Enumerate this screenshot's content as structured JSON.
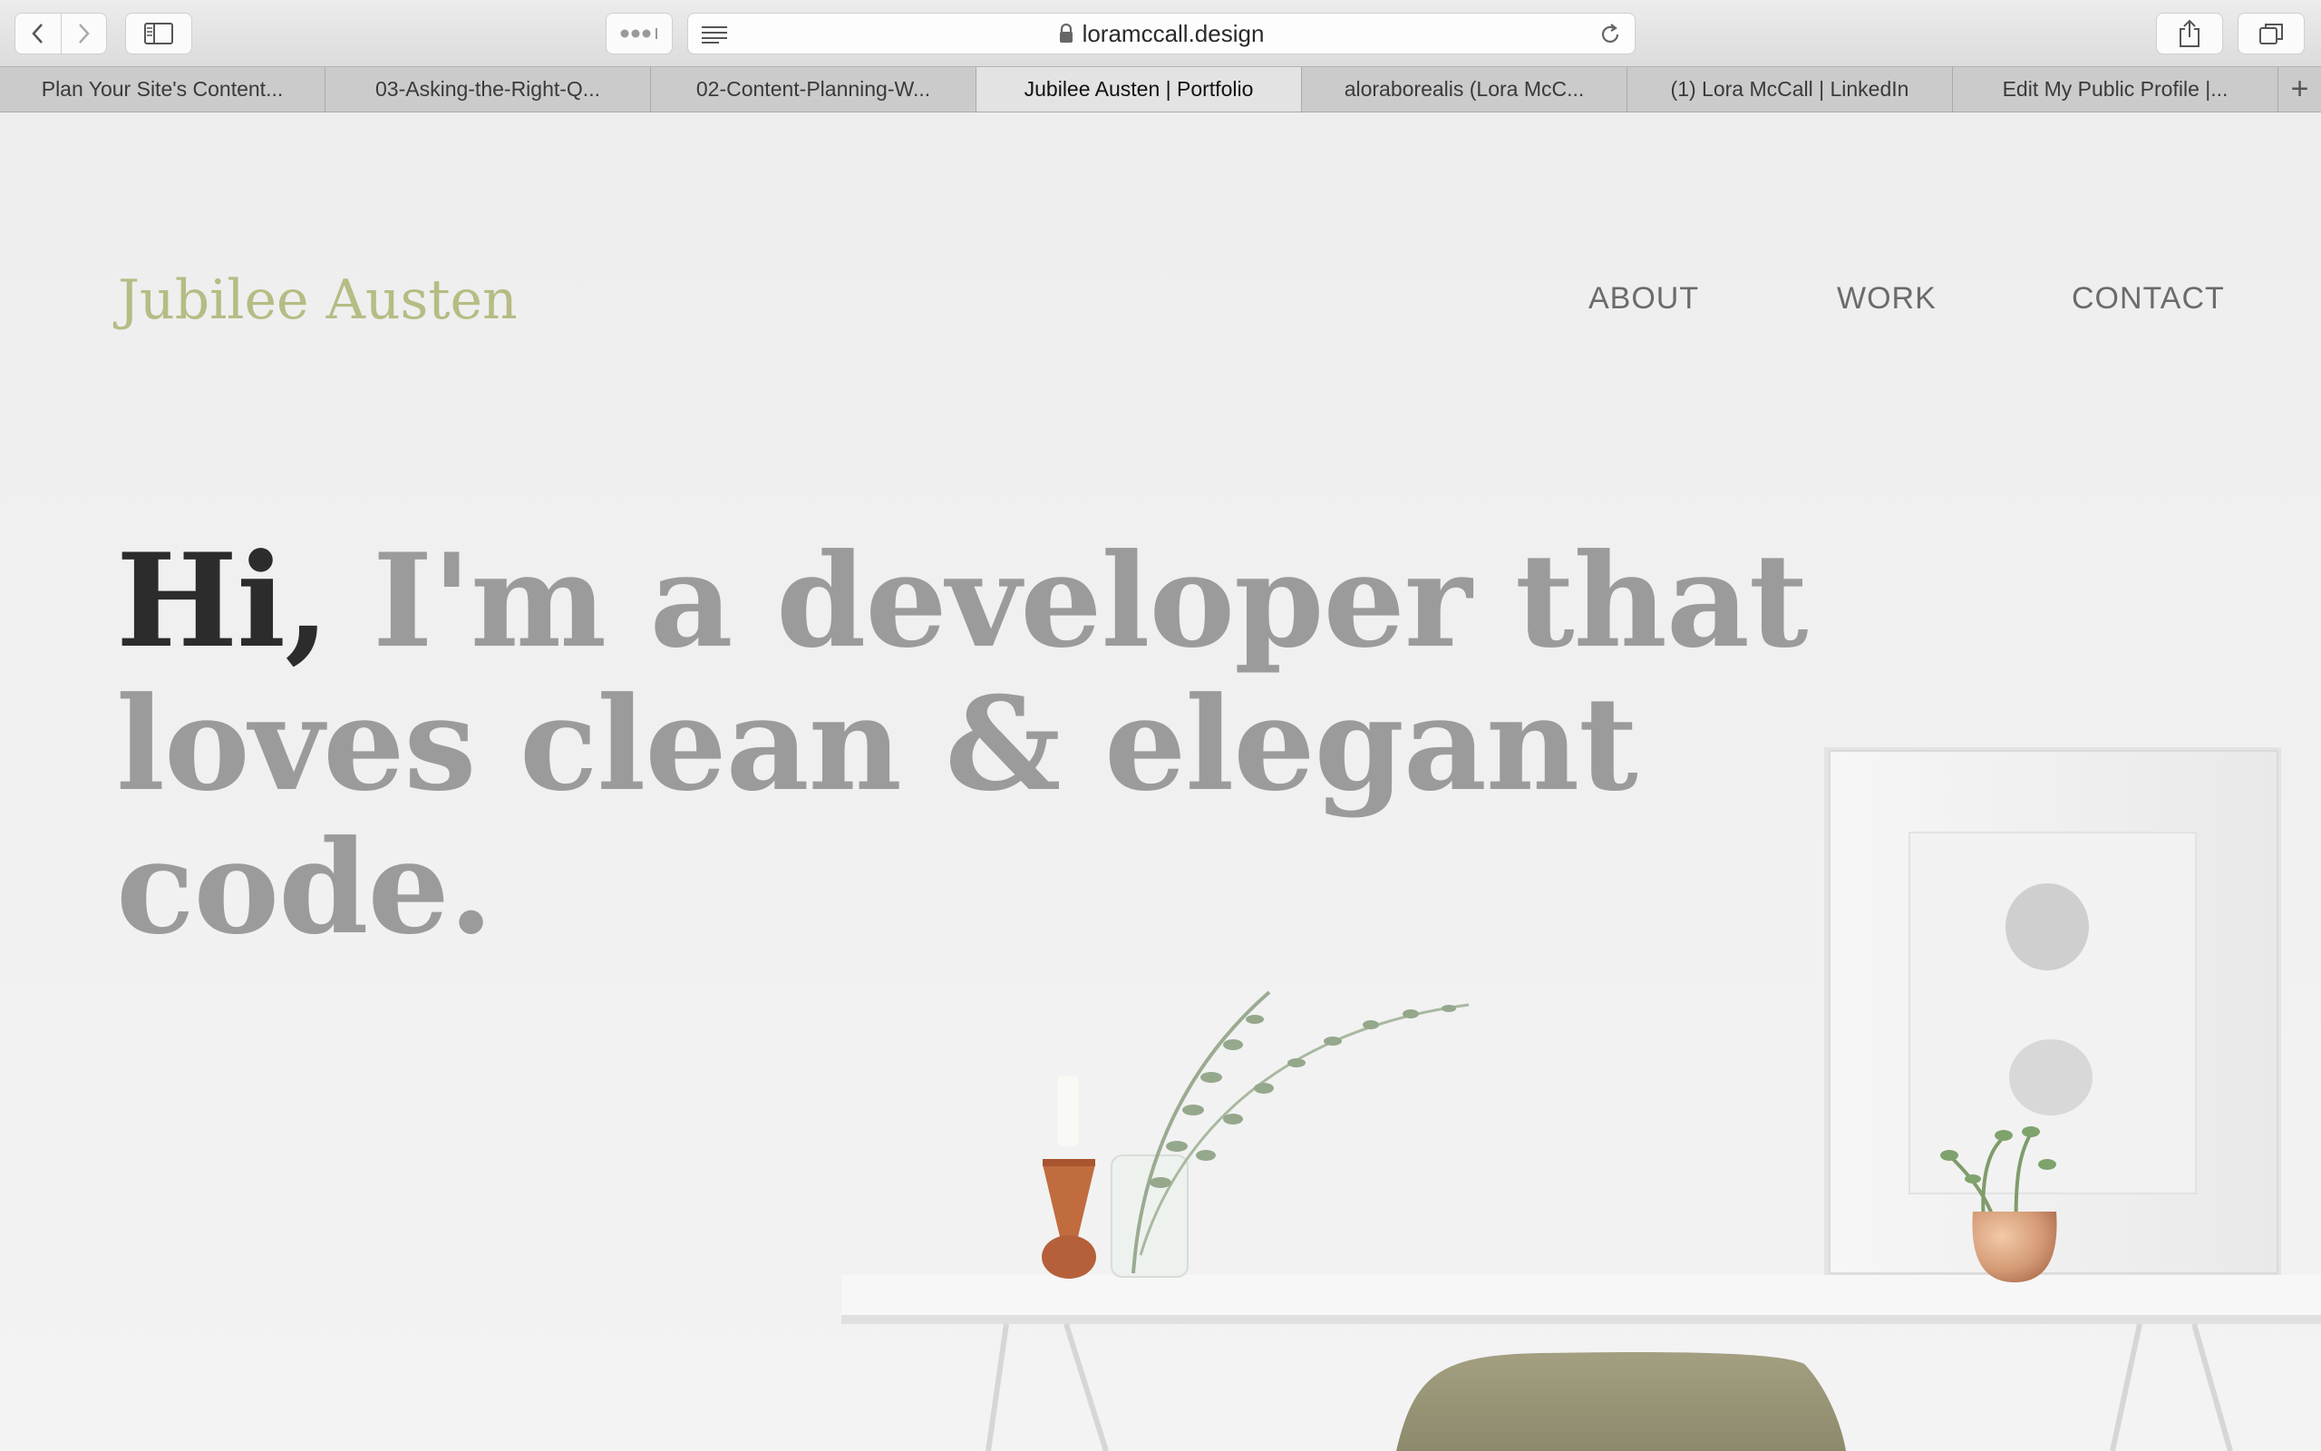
{
  "browser": {
    "url": "loramccall.design",
    "tabs": [
      {
        "label": "Plan Your Site's Content..."
      },
      {
        "label": "03-Asking-the-Right-Q..."
      },
      {
        "label": "02-Content-Planning-W..."
      },
      {
        "label": "Jubilee Austen | Portfolio"
      },
      {
        "label": "aloraborealis (Lora McC..."
      },
      {
        "label": "(1) Lora McCall | LinkedIn"
      },
      {
        "label": "Edit My Public Profile |..."
      }
    ],
    "active_tab_index": 3,
    "icons": {
      "back": "chevron-left-icon",
      "forward": "chevron-right-icon",
      "sidebar": "sidebar-icon",
      "more": "more-dots-icon",
      "reader": "reader-icon",
      "lock": "lock-icon",
      "reload": "reload-icon",
      "share": "share-icon",
      "tabs": "tabs-overview-icon",
      "new_tab": "plus-icon"
    },
    "new_tab_label": "+"
  },
  "site": {
    "logo": "Jubilee Austen",
    "nav": {
      "about": "ABOUT",
      "work": "WORK",
      "contact": "CONTACT"
    },
    "hero": {
      "greeting": "Hi,",
      "line1_rest": " I'm a developer that",
      "line2": "loves clean & elegant code."
    },
    "colors": {
      "logo": "#b6bc83",
      "nav": "#6b6b6b",
      "hero_greeting": "#2c2c2c",
      "hero_text": "#9b9b9b"
    }
  }
}
